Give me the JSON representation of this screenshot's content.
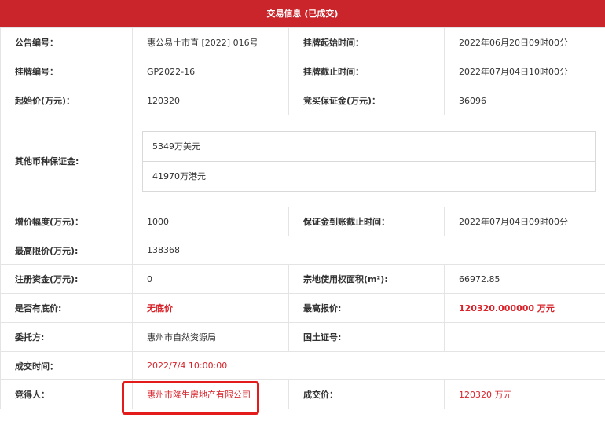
{
  "header": {
    "title": "交易信息 (已成交)"
  },
  "rows": {
    "announcement": {
      "label": "公告编号：",
      "value": "惠公易土市直 [2022] 016号",
      "label2": "挂牌起始时间：",
      "value2": "2022年06月20日09时00分"
    },
    "listing": {
      "label": "挂牌编号：",
      "value": "GP2022-16",
      "label2": "挂牌截止时间：",
      "value2": "2022年07月04日10时00分"
    },
    "start_price": {
      "label": "起始价(万元)：",
      "value": "120320",
      "label2": "竞买保证金(万元)：",
      "value2": "36096"
    },
    "other_currency": {
      "label": "其他币种保证金:",
      "items": [
        "5349万美元",
        "41970万港元"
      ]
    },
    "increment": {
      "label": "增价幅度(万元)：",
      "value": "1000",
      "label2": "保证金到账截止时间：",
      "value2": "2022年07月04日09时00分"
    },
    "max_price": {
      "label": "最高限价(万元):",
      "value": "138368"
    },
    "registered_capital": {
      "label": "注册资金(万元):",
      "value": "0",
      "label2": "宗地使用权面积(m²):",
      "value2": "66972.85"
    },
    "reserve": {
      "label": "是否有底价:",
      "value": "无底价",
      "label2": "最高报价:",
      "value2": "120320.000000 万元"
    },
    "entrust": {
      "label": "委托方:",
      "value": "惠州市自然资源局",
      "label2": "国土证号:",
      "value2": ""
    },
    "deal_time": {
      "label": "成交时间：",
      "value": "2022/7/4 10:00:00"
    },
    "winner": {
      "label": "竞得人：",
      "value": "惠州市隆生房地产有限公司",
      "label2": "成交价：",
      "value2": "120320 万元"
    }
  },
  "colors": {
    "header_bg": "#c9252a",
    "accent_red": "#d8232a",
    "border": "#e4e4e4",
    "highlight_box": "#e31b1b"
  }
}
